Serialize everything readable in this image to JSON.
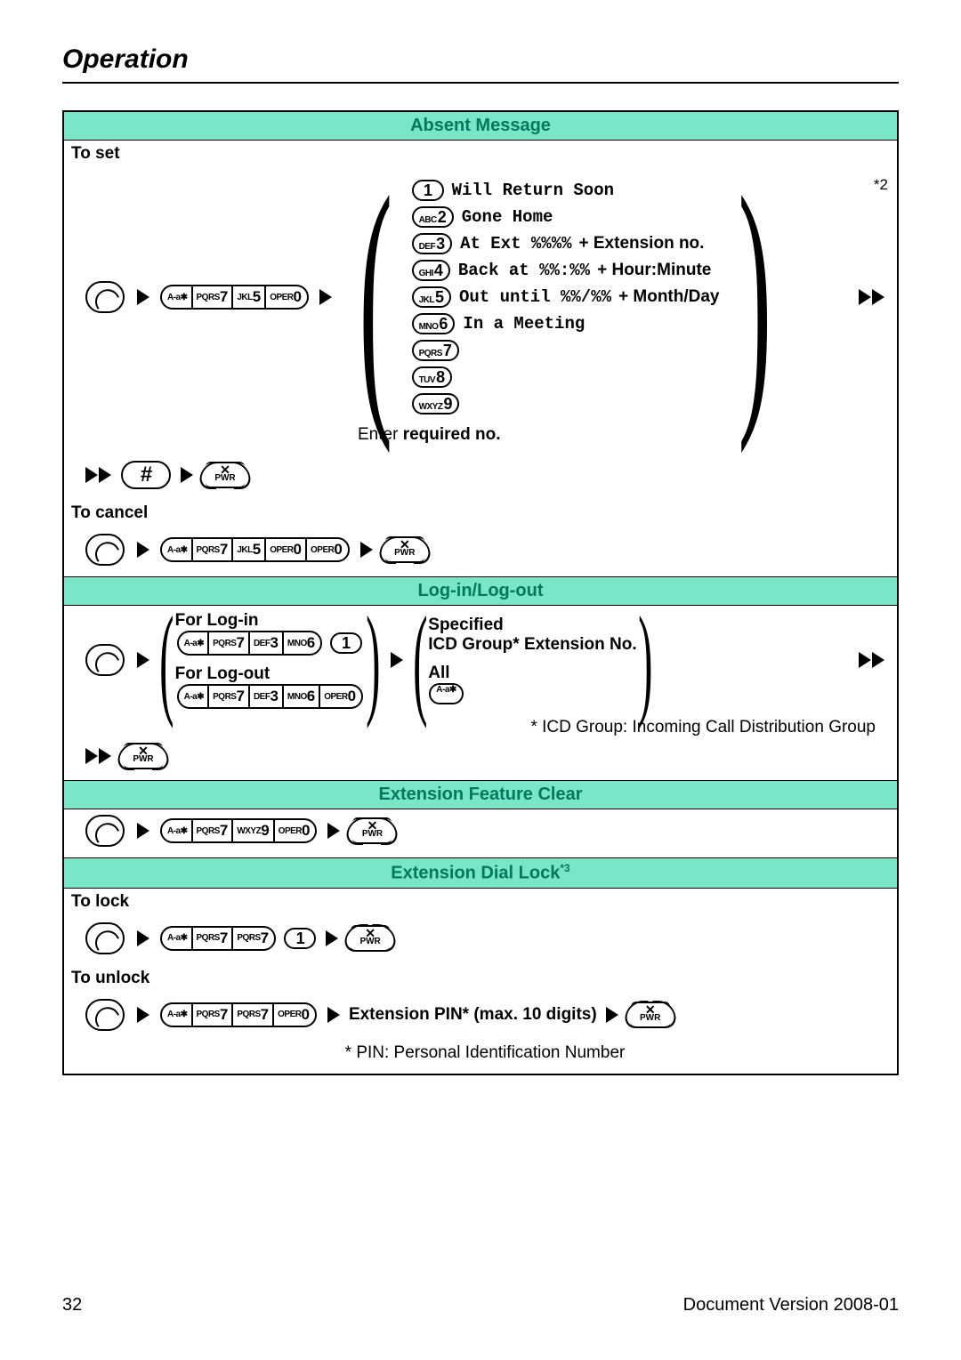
{
  "page": {
    "title": "Operation",
    "number": "32",
    "doc_version": "Document Version 2008-01"
  },
  "absent_message": {
    "header": "Absent Message",
    "to_set": "To set",
    "star2": "*2",
    "keys_set": [
      "A-a✱",
      "PQRS7",
      "JKL5",
      "OPER0"
    ],
    "messages": [
      {
        "key": "1",
        "pre": "",
        "text": "Will Return Soon",
        "suffix": ""
      },
      {
        "key": "2",
        "pre": "ABC",
        "text": "Gone Home",
        "suffix": ""
      },
      {
        "key": "3",
        "pre": "DEF",
        "text": "At Ext %%%%",
        "suffix": " + Extension no."
      },
      {
        "key": "4",
        "pre": "GHI",
        "text": "Back at %%:%%",
        "suffix": " + Hour:Minute"
      },
      {
        "key": "5",
        "pre": "JKL",
        "text": "Out until %%/%%",
        "suffix": " + Month/Day"
      },
      {
        "key": "6",
        "pre": "MNO",
        "text": "In a Meeting",
        "suffix": ""
      },
      {
        "key": "7",
        "pre": "PQRS",
        "text": "",
        "suffix": ""
      },
      {
        "key": "8",
        "pre": "TUV",
        "text": "",
        "suffix": ""
      },
      {
        "key": "9",
        "pre": "WXYZ",
        "text": "",
        "suffix": ""
      }
    ],
    "enter_required": "Enter ",
    "enter_required_bold": "required no.",
    "to_cancel": "To cancel",
    "keys_cancel": [
      "A-a✱",
      "PQRS7",
      "JKL5",
      "OPER0",
      "OPER0"
    ]
  },
  "login_logout": {
    "header": "Log-in/Log-out",
    "for_login": "For Log-in",
    "keys_login": [
      "A-a✱",
      "PQRS7",
      "DEF3",
      "MNO6"
    ],
    "login_last": "1",
    "for_logout": "For Log-out",
    "keys_logout": [
      "A-a✱",
      "PQRS7",
      "DEF3",
      "MNO6",
      "OPER0"
    ],
    "specified": "Specified",
    "icd_line": "ICD Group* Extension No.",
    "all": "All",
    "all_key": "A-a✱",
    "footnote": "* ICD Group: Incoming Call Distribution Group"
  },
  "feature_clear": {
    "header": "Extension Feature Clear",
    "keys": [
      "A-a✱",
      "PQRS7",
      "WXYZ9",
      "OPER0"
    ]
  },
  "dial_lock": {
    "header": "Extension Dial Lock",
    "header_sup": "*3",
    "to_lock": "To lock",
    "keys_lock": [
      "A-a✱",
      "PQRS7",
      "PQRS7"
    ],
    "lock_last": "1",
    "to_unlock": "To unlock",
    "keys_unlock": [
      "A-a✱",
      "PQRS7",
      "PQRS7",
      "OPER0"
    ],
    "pin_text": "Extension PIN* (max. 10 digits)",
    "pin_footnote": "* PIN: Personal Identification Number"
  }
}
